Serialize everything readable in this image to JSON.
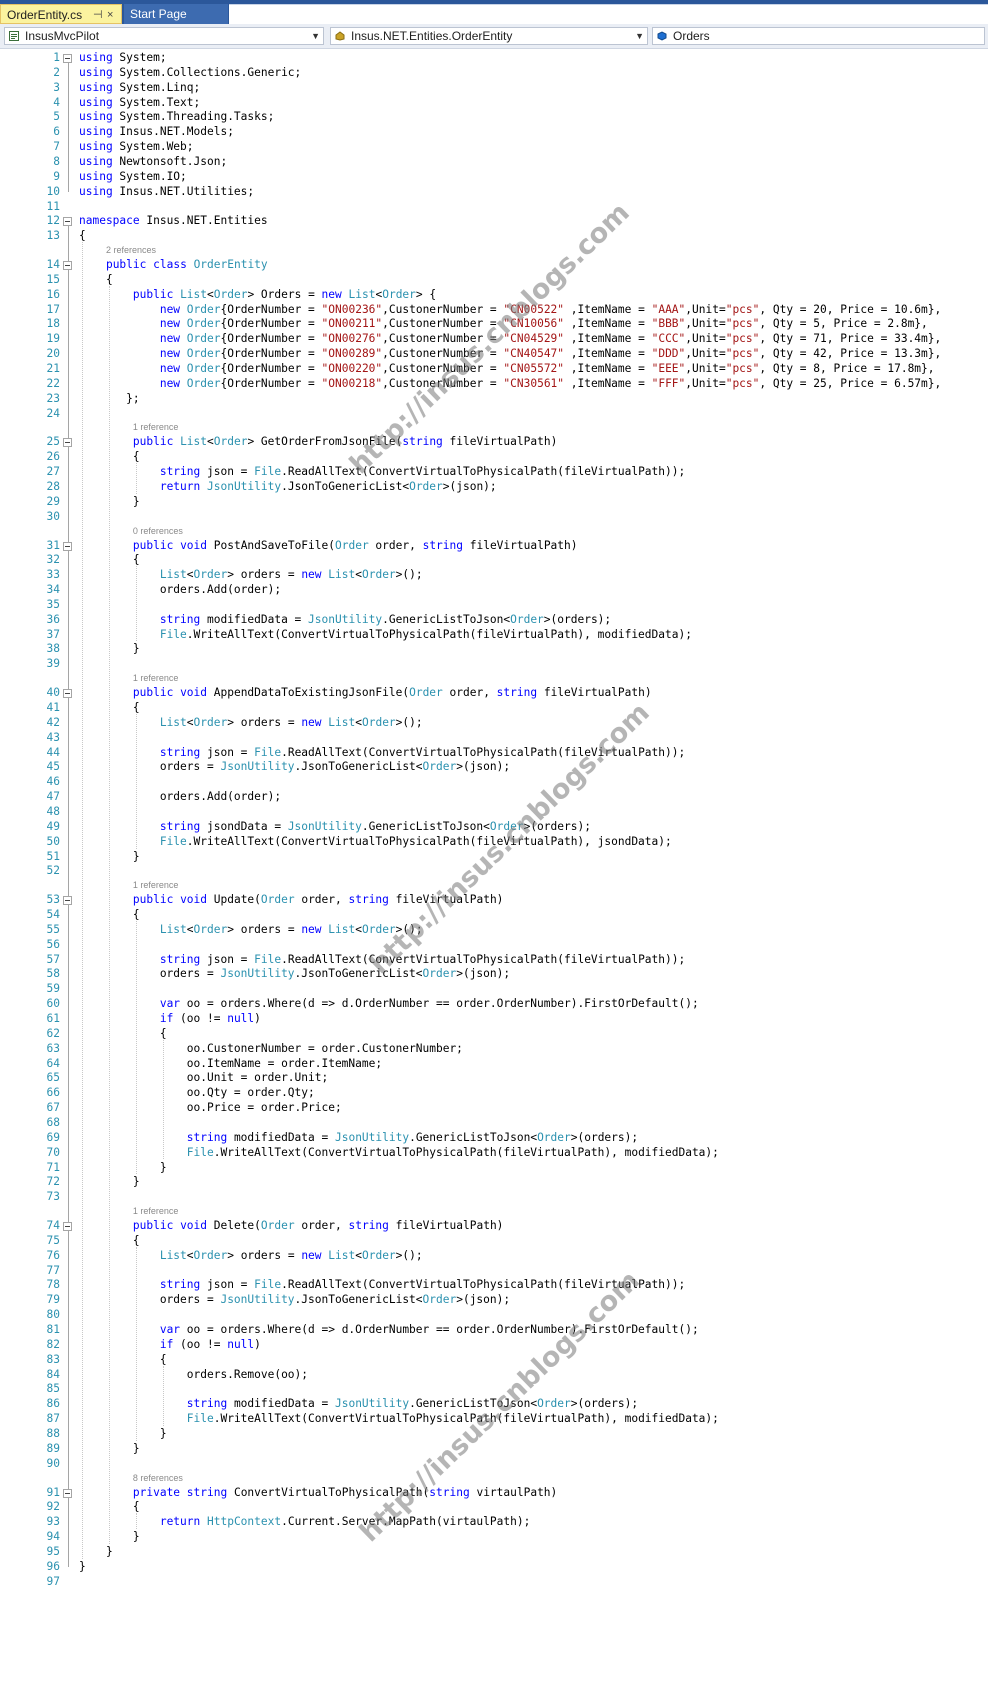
{
  "tabs": [
    {
      "label": "OrderEntity.cs",
      "pin": "⊣",
      "close": "×"
    },
    {
      "label": "Start Page"
    }
  ],
  "nav": {
    "project": "InsusMvcPilot",
    "type": "Insus.NET.Entities.OrderEntity",
    "member": "Orders"
  },
  "watermark": "http://insus.cnblogs.com",
  "lens": {
    "14": "2 references",
    "25": "1 reference",
    "31": "0 references",
    "40": "1 reference",
    "53": "1 reference",
    "74": "1 reference",
    "91": "8 references"
  },
  "lines": [
    [
      [
        "k",
        "using"
      ],
      [
        "p",
        " System;"
      ]
    ],
    [
      [
        "k",
        "using"
      ],
      [
        "p",
        " System.Collections.Generic;"
      ]
    ],
    [
      [
        "k",
        "using"
      ],
      [
        "p",
        " System.Linq;"
      ]
    ],
    [
      [
        "k",
        "using"
      ],
      [
        "p",
        " System.Text;"
      ]
    ],
    [
      [
        "k",
        "using"
      ],
      [
        "p",
        " System.Threading.Tasks;"
      ]
    ],
    [
      [
        "k",
        "using"
      ],
      [
        "p",
        " Insus.NET.Models;"
      ]
    ],
    [
      [
        "k",
        "using"
      ],
      [
        "p",
        " System.Web;"
      ]
    ],
    [
      [
        "k",
        "using"
      ],
      [
        "p",
        " Newtonsoft.Json;"
      ]
    ],
    [
      [
        "k",
        "using"
      ],
      [
        "p",
        " System.IO;"
      ]
    ],
    [
      [
        "k",
        "using"
      ],
      [
        "p",
        " Insus.NET.Utilities;"
      ]
    ],
    [],
    [
      [
        "k",
        "namespace"
      ],
      [
        "p",
        " Insus.NET.Entities"
      ]
    ],
    [
      [
        "p",
        "{"
      ]
    ],
    [
      [
        "p",
        "    "
      ],
      [
        "k",
        "public"
      ],
      [
        "p",
        " "
      ],
      [
        "k",
        "class"
      ],
      [
        "p",
        " "
      ],
      [
        "t",
        "OrderEntity"
      ]
    ],
    [
      [
        "p",
        "    {"
      ]
    ],
    [
      [
        "p",
        "        "
      ],
      [
        "k",
        "public"
      ],
      [
        "p",
        " "
      ],
      [
        "t",
        "List"
      ],
      [
        "p",
        "<"
      ],
      [
        "t",
        "Order"
      ],
      [
        "p",
        "> Orders = "
      ],
      [
        "k",
        "new"
      ],
      [
        "p",
        " "
      ],
      [
        "t",
        "List"
      ],
      [
        "p",
        "<"
      ],
      [
        "t",
        "Order"
      ],
      [
        "p",
        "> {"
      ]
    ],
    [
      [
        "p",
        "            "
      ],
      [
        "k",
        "new"
      ],
      [
        "p",
        " "
      ],
      [
        "t",
        "Order"
      ],
      [
        "p",
        "{OrderNumber = "
      ],
      [
        "s",
        "\"ON00236\""
      ],
      [
        "p",
        ",CustonerNumber = "
      ],
      [
        "s",
        "\"CN00522\""
      ],
      [
        "p",
        " ,ItemName = "
      ],
      [
        "s",
        "\"AAA\""
      ],
      [
        "p",
        ",Unit="
      ],
      [
        "s",
        "\"pcs\""
      ],
      [
        "p",
        ", Qty = 20, Price = 10.6m},"
      ]
    ],
    [
      [
        "p",
        "            "
      ],
      [
        "k",
        "new"
      ],
      [
        "p",
        " "
      ],
      [
        "t",
        "Order"
      ],
      [
        "p",
        "{OrderNumber = "
      ],
      [
        "s",
        "\"ON00211\""
      ],
      [
        "p",
        ",CustonerNumber = "
      ],
      [
        "s",
        "\"CN10056\""
      ],
      [
        "p",
        " ,ItemName = "
      ],
      [
        "s",
        "\"BBB\""
      ],
      [
        "p",
        ",Unit="
      ],
      [
        "s",
        "\"pcs\""
      ],
      [
        "p",
        ", Qty = 5, Price = 2.8m},"
      ]
    ],
    [
      [
        "p",
        "            "
      ],
      [
        "k",
        "new"
      ],
      [
        "p",
        " "
      ],
      [
        "t",
        "Order"
      ],
      [
        "p",
        "{OrderNumber = "
      ],
      [
        "s",
        "\"ON00276\""
      ],
      [
        "p",
        ",CustonerNumber = "
      ],
      [
        "s",
        "\"CN04529\""
      ],
      [
        "p",
        " ,ItemName = "
      ],
      [
        "s",
        "\"CCC\""
      ],
      [
        "p",
        ",Unit="
      ],
      [
        "s",
        "\"pcs\""
      ],
      [
        "p",
        ", Qty = 71, Price = 33.4m},"
      ]
    ],
    [
      [
        "p",
        "            "
      ],
      [
        "k",
        "new"
      ],
      [
        "p",
        " "
      ],
      [
        "t",
        "Order"
      ],
      [
        "p",
        "{OrderNumber = "
      ],
      [
        "s",
        "\"ON00289\""
      ],
      [
        "p",
        ",CustonerNumber = "
      ],
      [
        "s",
        "\"CN40547\""
      ],
      [
        "p",
        " ,ItemName = "
      ],
      [
        "s",
        "\"DDD\""
      ],
      [
        "p",
        ",Unit="
      ],
      [
        "s",
        "\"pcs\""
      ],
      [
        "p",
        ", Qty = 42, Price = 13.3m},"
      ]
    ],
    [
      [
        "p",
        "            "
      ],
      [
        "k",
        "new"
      ],
      [
        "p",
        " "
      ],
      [
        "t",
        "Order"
      ],
      [
        "p",
        "{OrderNumber = "
      ],
      [
        "s",
        "\"ON00220\""
      ],
      [
        "p",
        ",CustonerNumber = "
      ],
      [
        "s",
        "\"CN05572\""
      ],
      [
        "p",
        " ,ItemName = "
      ],
      [
        "s",
        "\"EEE\""
      ],
      [
        "p",
        ",Unit="
      ],
      [
        "s",
        "\"pcs\""
      ],
      [
        "p",
        ", Qty = 8, Price = 17.8m},"
      ]
    ],
    [
      [
        "p",
        "            "
      ],
      [
        "k",
        "new"
      ],
      [
        "p",
        " "
      ],
      [
        "t",
        "Order"
      ],
      [
        "p",
        "{OrderNumber = "
      ],
      [
        "s",
        "\"ON00218\""
      ],
      [
        "p",
        ",CustonerNumber = "
      ],
      [
        "s",
        "\"CN30561\""
      ],
      [
        "p",
        " ,ItemName = "
      ],
      [
        "s",
        "\"FFF\""
      ],
      [
        "p",
        ",Unit="
      ],
      [
        "s",
        "\"pcs\""
      ],
      [
        "p",
        ", Qty = 25, Price = 6.57m},"
      ]
    ],
    [
      [
        "p",
        "       };"
      ]
    ],
    [],
    [
      [
        "p",
        "        "
      ],
      [
        "k",
        "public"
      ],
      [
        "p",
        " "
      ],
      [
        "t",
        "List"
      ],
      [
        "p",
        "<"
      ],
      [
        "t",
        "Order"
      ],
      [
        "p",
        "> GetOrderFromJsonFile("
      ],
      [
        "k",
        "string"
      ],
      [
        "p",
        " fileVirtualPath)"
      ]
    ],
    [
      [
        "p",
        "        {"
      ]
    ],
    [
      [
        "p",
        "            "
      ],
      [
        "k",
        "string"
      ],
      [
        "p",
        " json = "
      ],
      [
        "t",
        "File"
      ],
      [
        "p",
        ".ReadAllText(ConvertVirtualToPhysicalPath(fileVirtualPath));"
      ]
    ],
    [
      [
        "p",
        "            "
      ],
      [
        "k",
        "return"
      ],
      [
        "p",
        " "
      ],
      [
        "t",
        "JsonUtility"
      ],
      [
        "p",
        ".JsonToGenericList<"
      ],
      [
        "t",
        "Order"
      ],
      [
        "p",
        ">(json);"
      ]
    ],
    [
      [
        "p",
        "        }"
      ]
    ],
    [],
    [
      [
        "p",
        "        "
      ],
      [
        "k",
        "public"
      ],
      [
        "p",
        " "
      ],
      [
        "k",
        "void"
      ],
      [
        "p",
        " PostAndSaveToFile("
      ],
      [
        "t",
        "Order"
      ],
      [
        "p",
        " order, "
      ],
      [
        "k",
        "string"
      ],
      [
        "p",
        " fileVirtualPath)"
      ]
    ],
    [
      [
        "p",
        "        {"
      ]
    ],
    [
      [
        "p",
        "            "
      ],
      [
        "t",
        "List"
      ],
      [
        "p",
        "<"
      ],
      [
        "t",
        "Order"
      ],
      [
        "p",
        "> orders = "
      ],
      [
        "k",
        "new"
      ],
      [
        "p",
        " "
      ],
      [
        "t",
        "List"
      ],
      [
        "p",
        "<"
      ],
      [
        "t",
        "Order"
      ],
      [
        "p",
        ">();"
      ]
    ],
    [
      [
        "p",
        "            orders.Add(order);"
      ]
    ],
    [],
    [
      [
        "p",
        "            "
      ],
      [
        "k",
        "string"
      ],
      [
        "p",
        " modifiedData = "
      ],
      [
        "t",
        "JsonUtility"
      ],
      [
        "p",
        ".GenericListToJson<"
      ],
      [
        "t",
        "Order"
      ],
      [
        "p",
        ">(orders);"
      ]
    ],
    [
      [
        "p",
        "            "
      ],
      [
        "t",
        "File"
      ],
      [
        "p",
        ".WriteAllText(ConvertVirtualToPhysicalPath(fileVirtualPath), modifiedData);"
      ]
    ],
    [
      [
        "p",
        "        }"
      ]
    ],
    [],
    [
      [
        "p",
        "        "
      ],
      [
        "k",
        "public"
      ],
      [
        "p",
        " "
      ],
      [
        "k",
        "void"
      ],
      [
        "p",
        " AppendDataToExistingJsonFile("
      ],
      [
        "t",
        "Order"
      ],
      [
        "p",
        " order, "
      ],
      [
        "k",
        "string"
      ],
      [
        "p",
        " fileVirtualPath)"
      ]
    ],
    [
      [
        "p",
        "        {"
      ]
    ],
    [
      [
        "p",
        "            "
      ],
      [
        "t",
        "List"
      ],
      [
        "p",
        "<"
      ],
      [
        "t",
        "Order"
      ],
      [
        "p",
        "> orders = "
      ],
      [
        "k",
        "new"
      ],
      [
        "p",
        " "
      ],
      [
        "t",
        "List"
      ],
      [
        "p",
        "<"
      ],
      [
        "t",
        "Order"
      ],
      [
        "p",
        ">();"
      ]
    ],
    [],
    [
      [
        "p",
        "            "
      ],
      [
        "k",
        "string"
      ],
      [
        "p",
        " json = "
      ],
      [
        "t",
        "File"
      ],
      [
        "p",
        ".ReadAllText(ConvertVirtualToPhysicalPath(fileVirtualPath));"
      ]
    ],
    [
      [
        "p",
        "            orders = "
      ],
      [
        "t",
        "JsonUtility"
      ],
      [
        "p",
        ".JsonToGenericList<"
      ],
      [
        "t",
        "Order"
      ],
      [
        "p",
        ">(json);"
      ]
    ],
    [],
    [
      [
        "p",
        "            orders.Add(order);"
      ]
    ],
    [],
    [
      [
        "p",
        "            "
      ],
      [
        "k",
        "string"
      ],
      [
        "p",
        " jsondData = "
      ],
      [
        "t",
        "JsonUtility"
      ],
      [
        "p",
        ".GenericListToJson<"
      ],
      [
        "t",
        "Order"
      ],
      [
        "p",
        ">(orders);"
      ]
    ],
    [
      [
        "p",
        "            "
      ],
      [
        "t",
        "File"
      ],
      [
        "p",
        ".WriteAllText(ConvertVirtualToPhysicalPath(fileVirtualPath), jsondData);"
      ]
    ],
    [
      [
        "p",
        "        }"
      ]
    ],
    [],
    [
      [
        "p",
        "        "
      ],
      [
        "k",
        "public"
      ],
      [
        "p",
        " "
      ],
      [
        "k",
        "void"
      ],
      [
        "p",
        " Update("
      ],
      [
        "t",
        "Order"
      ],
      [
        "p",
        " order, "
      ],
      [
        "k",
        "string"
      ],
      [
        "p",
        " fileVirtualPath)"
      ]
    ],
    [
      [
        "p",
        "        {"
      ]
    ],
    [
      [
        "p",
        "            "
      ],
      [
        "t",
        "List"
      ],
      [
        "p",
        "<"
      ],
      [
        "t",
        "Order"
      ],
      [
        "p",
        "> orders = "
      ],
      [
        "k",
        "new"
      ],
      [
        "p",
        " "
      ],
      [
        "t",
        "List"
      ],
      [
        "p",
        "<"
      ],
      [
        "t",
        "Order"
      ],
      [
        "p",
        ">();"
      ]
    ],
    [],
    [
      [
        "p",
        "            "
      ],
      [
        "k",
        "string"
      ],
      [
        "p",
        " json = "
      ],
      [
        "t",
        "File"
      ],
      [
        "p",
        ".ReadAllText(ConvertVirtualToPhysicalPath(fileVirtualPath));"
      ]
    ],
    [
      [
        "p",
        "            orders = "
      ],
      [
        "t",
        "JsonUtility"
      ],
      [
        "p",
        ".JsonToGenericList<"
      ],
      [
        "t",
        "Order"
      ],
      [
        "p",
        ">(json);"
      ]
    ],
    [],
    [
      [
        "p",
        "            "
      ],
      [
        "k",
        "var"
      ],
      [
        "p",
        " oo = orders.Where(d => d.OrderNumber == order.OrderNumber).FirstOrDefault();"
      ]
    ],
    [
      [
        "p",
        "            "
      ],
      [
        "k",
        "if"
      ],
      [
        "p",
        " (oo != "
      ],
      [
        "k",
        "null"
      ],
      [
        "p",
        ")"
      ]
    ],
    [
      [
        "p",
        "            {"
      ]
    ],
    [
      [
        "p",
        "                oo.CustonerNumber = order.CustonerNumber;"
      ]
    ],
    [
      [
        "p",
        "                oo.ItemName = order.ItemName;"
      ]
    ],
    [
      [
        "p",
        "                oo.Unit = order.Unit;"
      ]
    ],
    [
      [
        "p",
        "                oo.Qty = order.Qty;"
      ]
    ],
    [
      [
        "p",
        "                oo.Price = order.Price;"
      ]
    ],
    [],
    [
      [
        "p",
        "                "
      ],
      [
        "k",
        "string"
      ],
      [
        "p",
        " modifiedData = "
      ],
      [
        "t",
        "JsonUtility"
      ],
      [
        "p",
        ".GenericListToJson<"
      ],
      [
        "t",
        "Order"
      ],
      [
        "p",
        ">(orders);"
      ]
    ],
    [
      [
        "p",
        "                "
      ],
      [
        "t",
        "File"
      ],
      [
        "p",
        ".WriteAllText(ConvertVirtualToPhysicalPath(fileVirtualPath), modifiedData);"
      ]
    ],
    [
      [
        "p",
        "            }"
      ]
    ],
    [
      [
        "p",
        "        }"
      ]
    ],
    [],
    [
      [
        "p",
        "        "
      ],
      [
        "k",
        "public"
      ],
      [
        "p",
        " "
      ],
      [
        "k",
        "void"
      ],
      [
        "p",
        " Delete("
      ],
      [
        "t",
        "Order"
      ],
      [
        "p",
        " order, "
      ],
      [
        "k",
        "string"
      ],
      [
        "p",
        " fileVirtualPath)"
      ]
    ],
    [
      [
        "p",
        "        {"
      ]
    ],
    [
      [
        "p",
        "            "
      ],
      [
        "t",
        "List"
      ],
      [
        "p",
        "<"
      ],
      [
        "t",
        "Order"
      ],
      [
        "p",
        "> orders = "
      ],
      [
        "k",
        "new"
      ],
      [
        "p",
        " "
      ],
      [
        "t",
        "List"
      ],
      [
        "p",
        "<"
      ],
      [
        "t",
        "Order"
      ],
      [
        "p",
        ">();"
      ]
    ],
    [],
    [
      [
        "p",
        "            "
      ],
      [
        "k",
        "string"
      ],
      [
        "p",
        " json = "
      ],
      [
        "t",
        "File"
      ],
      [
        "p",
        ".ReadAllText(ConvertVirtualToPhysicalPath(fileVirtualPath));"
      ]
    ],
    [
      [
        "p",
        "            orders = "
      ],
      [
        "t",
        "JsonUtility"
      ],
      [
        "p",
        ".JsonToGenericList<"
      ],
      [
        "t",
        "Order"
      ],
      [
        "p",
        ">(json);"
      ]
    ],
    [],
    [
      [
        "p",
        "            "
      ],
      [
        "k",
        "var"
      ],
      [
        "p",
        " oo = orders.Where(d => d.OrderNumber == order.OrderNumber).FirstOrDefault();"
      ]
    ],
    [
      [
        "p",
        "            "
      ],
      [
        "k",
        "if"
      ],
      [
        "p",
        " (oo != "
      ],
      [
        "k",
        "null"
      ],
      [
        "p",
        ")"
      ]
    ],
    [
      [
        "p",
        "            {"
      ]
    ],
    [
      [
        "p",
        "                orders.Remove(oo);"
      ]
    ],
    [],
    [
      [
        "p",
        "                "
      ],
      [
        "k",
        "string"
      ],
      [
        "p",
        " modifiedData = "
      ],
      [
        "t",
        "JsonUtility"
      ],
      [
        "p",
        ".GenericListToJson<"
      ],
      [
        "t",
        "Order"
      ],
      [
        "p",
        ">(orders);"
      ]
    ],
    [
      [
        "p",
        "                "
      ],
      [
        "t",
        "File"
      ],
      [
        "p",
        ".WriteAllText(ConvertVirtualToPhysicalPath(fileVirtualPath), modifiedData);"
      ]
    ],
    [
      [
        "p",
        "            }"
      ]
    ],
    [
      [
        "p",
        "        }"
      ]
    ],
    [],
    [
      [
        "p",
        "        "
      ],
      [
        "k",
        "private"
      ],
      [
        "p",
        " "
      ],
      [
        "k",
        "string"
      ],
      [
        "p",
        " ConvertVirtualToPhysicalPath("
      ],
      [
        "k",
        "string"
      ],
      [
        "p",
        " virtaulPath)"
      ]
    ],
    [
      [
        "p",
        "        {"
      ]
    ],
    [
      [
        "p",
        "            "
      ],
      [
        "k",
        "return"
      ],
      [
        "p",
        " "
      ],
      [
        "t",
        "HttpContext"
      ],
      [
        "p",
        ".Current.Server.MapPath(virtaulPath);"
      ]
    ],
    [
      [
        "p",
        "        }"
      ]
    ],
    [
      [
        "p",
        "    }"
      ]
    ],
    [
      [
        "p",
        "}"
      ]
    ],
    []
  ]
}
